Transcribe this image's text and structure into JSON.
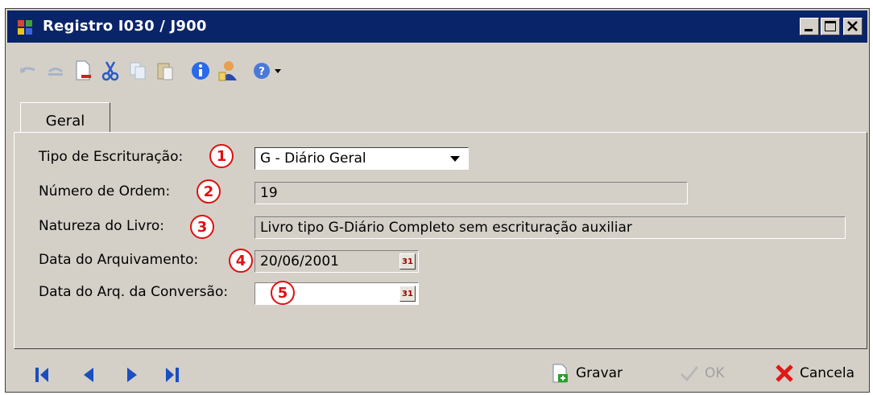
{
  "window": {
    "title": "Registro I030 / J900",
    "controls": {
      "minimize": "_",
      "maximize": "□",
      "close": "×"
    }
  },
  "toolbar": {
    "icons": [
      "undo-icon",
      "redo-icon",
      "new-document-icon",
      "cut-icon",
      "copy-icon",
      "paste-icon",
      "info-icon",
      "user-icon",
      "help-icon",
      "dropdown-arrow-icon"
    ]
  },
  "tabs": [
    {
      "label": "Geral",
      "active": true
    }
  ],
  "form": {
    "tipo_escrituracao": {
      "label": "Tipo de Escrituração:",
      "value": "G - Diário Geral",
      "badge": "1"
    },
    "numero_ordem": {
      "label": "Número de Ordem:",
      "value": "19",
      "badge": "2"
    },
    "natureza_livro": {
      "label": "Natureza do Livro:",
      "value": "Livro tipo G-Diário Completo sem escrituração auxiliar",
      "badge": "3"
    },
    "data_arquivamento": {
      "label": "Data do Arquivamento:",
      "value": "20/06/2001",
      "badge": "4"
    },
    "data_arq_conversao": {
      "label": "Data do Arq. da Conversão:",
      "value": "",
      "badge": "5"
    }
  },
  "calendar_icon_text": "31",
  "footer": {
    "nav": [
      "first-record-icon",
      "previous-record-icon",
      "next-record-icon",
      "last-record-icon"
    ],
    "save_label": "Gravar",
    "ok_label": "OK",
    "cancel_label": "Cancela"
  },
  "colors": {
    "titlebar": "#0a246a",
    "badge": "#e01010",
    "nav": "#1a4fc0"
  }
}
